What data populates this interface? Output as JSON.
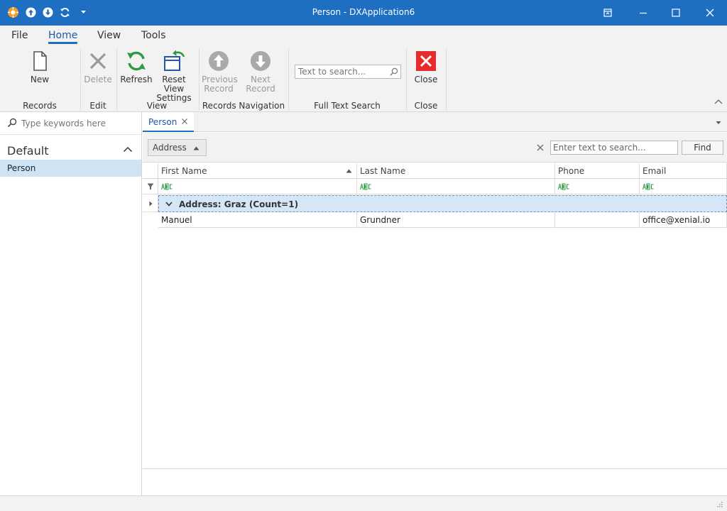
{
  "window": {
    "title": "Person - DXApplication6",
    "colors": {
      "titlebar": "#1e6fc2",
      "accent": "#1e6fc2",
      "selection": "#cde4f7"
    }
  },
  "ribbon": {
    "tabs": [
      {
        "label": "File"
      },
      {
        "label": "Home"
      },
      {
        "label": "View"
      },
      {
        "label": "Tools"
      }
    ],
    "buttons": {
      "new": "New",
      "delete": "Delete",
      "refresh": "Refresh",
      "reset_line1": "Reset View",
      "reset_line2": "Settings",
      "previous_line1": "Previous",
      "previous_line2": "Record",
      "next": "Next Record",
      "close": "Close"
    },
    "search_placeholder": "Text to search...",
    "groups": {
      "records_creation": "Records Creation",
      "edit": "Edit",
      "view": "View",
      "records_navigation": "Records Navigation",
      "full_text_search": "Full Text Search",
      "close": "Close"
    }
  },
  "navigation": {
    "search_placeholder": "Type keywords here",
    "group_label": "Default",
    "items": [
      {
        "label": "Person"
      }
    ]
  },
  "document": {
    "tab_label": "Person"
  },
  "group_panel": {
    "group_chip": "Address",
    "find_placeholder": "Enter text to search...",
    "find_button": "Find"
  },
  "grid": {
    "columns": [
      "First Name",
      "Last Name",
      "Phone",
      "Email"
    ],
    "group_row": "Address: Graz (Count=1)",
    "rows": [
      {
        "first_name": "Manuel",
        "last_name": "Grundner",
        "phone": "",
        "email": "office@xenial.io"
      }
    ]
  }
}
